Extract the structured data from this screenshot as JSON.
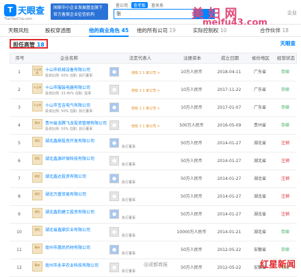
{
  "header": {
    "logo_mark": "T",
    "logo_name": "天眼查",
    "logo_url": "TianYanCha.com",
    "promo": "国家中小企业发展基金旗下官方备案企业征信机构",
    "search_tabs": [
      "查公司",
      "查老板",
      "查关系"
    ],
    "search_value": "张",
    "watermark": "美 妇 网",
    "watermark_url": "meifu43.com",
    "right_text": "企业"
  },
  "tabs": [
    {
      "label": "天眼风险",
      "count": ""
    },
    {
      "label": "股权穿透图",
      "count": ""
    },
    {
      "label": "他的商业角色",
      "count": "45"
    },
    {
      "label": "他的所有公司",
      "count": "19"
    },
    {
      "label": "实际控制权",
      "count": "10"
    },
    {
      "label": "合作伙伴",
      "count": "18"
    }
  ],
  "section": {
    "title": "担任高管",
    "count": "18",
    "brand": "天眼查"
  },
  "table": {
    "headers": [
      "序号",
      "企业名称",
      "法定代表人",
      "注册资本",
      "成立日期",
      "省份地区",
      "经营状态"
    ],
    "rows": [
      {
        "no": "1",
        "logo": "十山市机",
        "name": "十山市机械设备有限公司",
        "info": "投资比例: 50%  任职: 执行董事",
        "legal": "",
        "note": "他有 2 1 家公司 >",
        "capital": "10万人民币",
        "date": "2018-04-11",
        "region": "广东省",
        "status": "存续"
      },
      {
        "no": "2",
        "logo": "十山市",
        "name": "十山市服装电器有限公司",
        "info": "投资比例: 33.40%  任职: 监事",
        "legal": "",
        "note": "他有 2 1 家公司 >",
        "capital": "10万人民币",
        "date": "2017-11-22",
        "region": "广东省",
        "status": "存续"
      },
      {
        "no": "3",
        "logo": "十山市",
        "name": "十山市宝吉电气有限公司",
        "info": "投资比例: 50%  任职: 执行董事",
        "legal": "",
        "note": "他有 2 1 家公司 >",
        "capital": "10万人民币",
        "date": "2017-01-07",
        "region": "广东省",
        "status": "存续"
      },
      {
        "no": "4",
        "logo": "贵州",
        "name": "贵州省龙腾飞龙投资管理有限公司",
        "info": "投资比例: 50%  任职: 执行董事",
        "legal": "",
        "note": "他有 2 1 家公司 >",
        "capital": "500万人民币",
        "date": "2016-05-09",
        "region": "贵州省",
        "status": "存续"
      },
      {
        "no": "5",
        "logo": "湖北",
        "name": "湖北鑫鼎投资开发有限公司",
        "info": "",
        "legal": "",
        "note": "执行董事",
        "capital": "50万人民币",
        "date": "2014-01-27",
        "region": "湖北省",
        "status": "注销"
      },
      {
        "no": "6",
        "logo": "湖北",
        "name": "湖北鑫源环保科技有限公司",
        "info": "",
        "legal": "",
        "note": "执行董事",
        "capital": "50万人民币",
        "date": "2014-01-27",
        "region": "湖北省",
        "status": "注销"
      },
      {
        "no": "7",
        "logo": "湖北",
        "name": "湖北鑫达投资有限公司",
        "info": "",
        "legal": "",
        "note": "执行董事",
        "capital": "50万人民币",
        "date": "2014-01-27",
        "region": "湖北省",
        "status": "注销"
      },
      {
        "no": "8",
        "logo": "湖北",
        "name": "湖北万盛贸易有限公司",
        "info": "",
        "legal": "",
        "note": "执行董事",
        "capital": "50万人民币",
        "date": "2014-01-27",
        "region": "湖北省",
        "status": "注销"
      },
      {
        "no": "9",
        "logo": "湖北",
        "name": "湖北鑫和建工投资有限公司",
        "info": "",
        "legal": "",
        "note": "执行董事",
        "capital": "50万人民币",
        "date": "2014-01-27",
        "region": "湖北省",
        "status": "注销"
      },
      {
        "no": "10",
        "logo": "湖北",
        "name": "湖北省鑫鼎实业有限公司",
        "info": "",
        "legal": "",
        "note": "执行董事",
        "capital": "10000万人民币",
        "date": "2014-01-21",
        "region": "湖北省",
        "status": "存续"
      },
      {
        "no": "11",
        "logo": "亳州",
        "name": "亳州市惠民药材有限公司",
        "info": "",
        "legal": "",
        "note": "执行董事",
        "capital": "50万人民币",
        "date": "2012-05-22",
        "region": "安徽省",
        "status": "存续"
      },
      {
        "no": "12",
        "logo": "亳州",
        "name": "亳州市永丰农业科技有限公司",
        "info": "",
        "legal": "",
        "note": "执行董事",
        "capital": "50万人民币",
        "date": "2012-05-22",
        "region": "安徽省",
        "status": "存续"
      }
    ]
  },
  "footer": {
    "credit": "@成都商报",
    "red_logo": "红星新闻"
  }
}
